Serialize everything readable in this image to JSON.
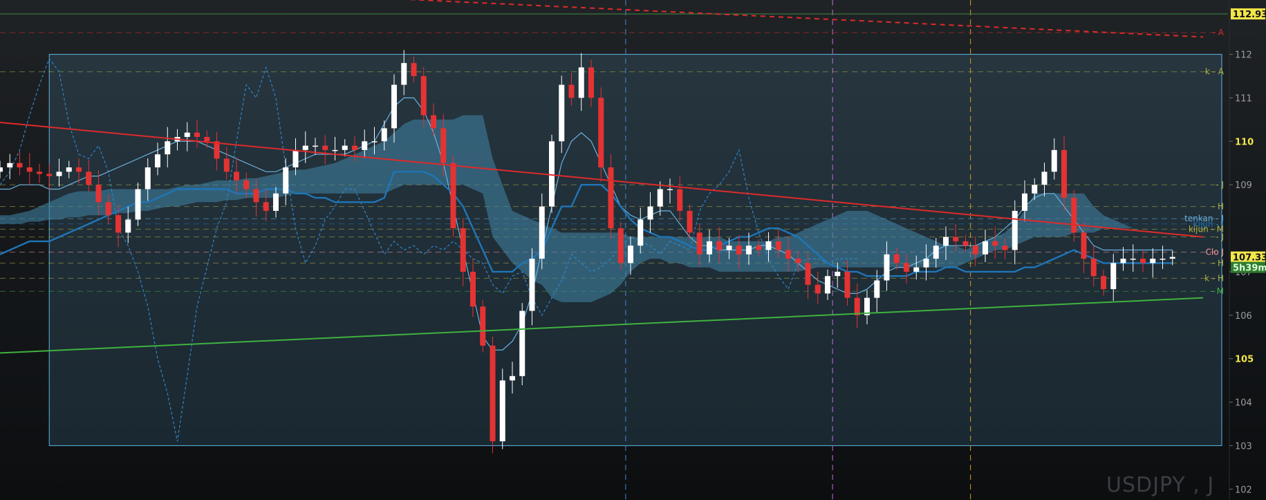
{
  "symbol": "USDJPY , J",
  "colors": {
    "bull": "#ffffff",
    "bear": "#e53333",
    "cloud": "#3f7f9f",
    "kijun": "#1f76b8",
    "tenkan": "#6bb3e0",
    "chikou": "#2f86c8",
    "red_line": "#e02a2a",
    "green_line": "#3fb33f",
    "level_yellow": "#b3b33f",
    "price_tag": "#f2e64a"
  },
  "chart_data": {
    "type": "candlestick",
    "ylim": [
      101.75,
      113.25
    ],
    "x_count": 120,
    "y_ticks": [
      {
        "value": 112,
        "label": "112",
        "major": false
      },
      {
        "value": 111,
        "label": "111",
        "major": false
      },
      {
        "value": 110,
        "label": "110",
        "major": true
      },
      {
        "value": 109,
        "label": "109",
        "major": false
      },
      {
        "value": 107,
        "label": "107",
        "major": false
      },
      {
        "value": 106,
        "label": "106",
        "major": false
      },
      {
        "value": 105,
        "label": "105",
        "major": true
      },
      {
        "value": 104,
        "label": "104",
        "major": false
      },
      {
        "value": 103,
        "label": "103",
        "major": false
      },
      {
        "value": 102,
        "label": "102",
        "major": false
      }
    ],
    "price_tags": [
      {
        "value": 112.93,
        "label": "112.93",
        "style": "yellow"
      },
      {
        "value": 107.339,
        "label": "107.339",
        "style": "yellow"
      },
      {
        "value": 107.1,
        "label": "5h39m",
        "style": "green"
      }
    ],
    "levels": [
      {
        "value": 112.5,
        "label": "- A",
        "color": "#e02a2a"
      },
      {
        "value": 111.6,
        "label": "k - A",
        "color": "#b3b33f"
      },
      {
        "value": 109.0,
        "label": "- J",
        "color": "#b3b33f"
      },
      {
        "value": 108.5,
        "label": "- H",
        "color": "#b3b33f"
      },
      {
        "value": 108.22,
        "label": "tenkan - J",
        "color": "#6bb3e0"
      },
      {
        "value": 108.1,
        "label": "kijun - J",
        "color": "#1f76b8"
      },
      {
        "value": 107.98,
        "label": "kijun - M",
        "color": "#b3b33f"
      },
      {
        "value": 107.8,
        "label": "- J",
        "color": "#b3b33f"
      },
      {
        "value": 107.45,
        "label": "Clo J",
        "color": "#ff9a9a"
      },
      {
        "value": 107.2,
        "label": "- H",
        "color": "#b3b33f"
      },
      {
        "value": 106.85,
        "label": "k - H",
        "color": "#b3b33f"
      },
      {
        "value": 106.55,
        "label": "- M",
        "color": "#3fb33f"
      },
      {
        "value": 101.55,
        "label": "- M",
        "color": "#c8c8c8"
      }
    ],
    "close_series": [
      109.4,
      109.5,
      109.4,
      109.3,
      109.25,
      109.2,
      109.3,
      109.4,
      109.3,
      109.0,
      108.6,
      108.3,
      107.9,
      108.2,
      108.9,
      109.4,
      109.7,
      110.0,
      110.1,
      110.2,
      110.1,
      110.0,
      109.6,
      109.3,
      109.1,
      108.9,
      108.6,
      108.4,
      108.8,
      109.4,
      109.8,
      109.9,
      109.9,
      109.8,
      109.8,
      109.9,
      109.8,
      110.0,
      110.0,
      110.3,
      111.3,
      111.8,
      111.5,
      110.6,
      110.3,
      109.5,
      108.0,
      107.0,
      106.2,
      105.3,
      103.1,
      104.5,
      104.6,
      106.1,
      107.3,
      108.5,
      110.0,
      111.3,
      111.0,
      111.7,
      111.0,
      109.4,
      108.0,
      107.2,
      107.6,
      108.2,
      108.5,
      108.9,
      108.9,
      108.4,
      107.9,
      107.4,
      107.7,
      107.5,
      107.6,
      107.4,
      107.6,
      107.5,
      107.7,
      107.5,
      107.3,
      107.2,
      106.7,
      106.5,
      106.9,
      107.0,
      106.4,
      106.0,
      106.4,
      106.8,
      107.4,
      107.2,
      107.0,
      107.1,
      107.3,
      107.6,
      107.8,
      107.7,
      107.6,
      107.4,
      107.7,
      107.6,
      107.5,
      108.4,
      108.8,
      109.0,
      109.3,
      109.8,
      108.7,
      107.9,
      107.3,
      106.9,
      106.6,
      107.2,
      107.3,
      107.3,
      107.2,
      107.3,
      107.3,
      107.34
    ],
    "kijun_series": [
      107.4,
      107.5,
      107.6,
      107.7,
      107.7,
      107.7,
      107.8,
      107.9,
      108.0,
      108.1,
      108.2,
      108.3,
      108.4,
      108.5,
      108.6,
      108.6,
      108.7,
      108.8,
      108.9,
      108.9,
      108.9,
      108.9,
      108.9,
      108.9,
      108.8,
      108.8,
      108.8,
      108.9,
      108.9,
      108.9,
      108.8,
      108.8,
      108.7,
      108.7,
      108.6,
      108.6,
      108.6,
      108.6,
      108.6,
      108.7,
      109.3,
      109.3,
      109.3,
      109.3,
      109.2,
      109.0,
      108.8,
      108.5,
      108.0,
      107.5,
      107.0,
      107.0,
      107.0,
      107.2,
      107.3,
      107.5,
      108.0,
      108.5,
      108.5,
      109.0,
      109.0,
      109.0,
      108.8,
      108.5,
      108.2,
      108.0,
      107.9,
      107.8,
      107.8,
      107.7,
      107.6,
      107.5,
      107.5,
      107.6,
      107.7,
      107.8,
      107.8,
      107.9,
      108.0,
      108.0,
      107.9,
      107.8,
      107.6,
      107.4,
      107.2,
      107.1,
      107.0,
      107.0,
      106.9,
      106.9,
      106.9,
      106.9,
      106.9,
      107.0,
      107.0,
      107.0,
      107.1,
      107.1,
      107.0,
      107.0,
      107.0,
      107.0,
      107.0,
      107.0,
      107.1,
      107.1,
      107.2,
      107.3,
      107.4,
      107.5,
      107.4,
      107.3,
      107.2,
      107.2,
      107.2,
      107.2,
      107.2,
      107.2,
      107.2,
      107.2
    ],
    "tenkan_series": [
      108.9,
      108.9,
      109.0,
      109.0,
      109.0,
      108.9,
      108.9,
      109.0,
      109.1,
      109.2,
      109.2,
      109.3,
      109.4,
      109.5,
      109.6,
      109.7,
      109.8,
      109.9,
      110.0,
      110.0,
      110.0,
      109.9,
      109.8,
      109.7,
      109.6,
      109.5,
      109.4,
      109.3,
      109.3,
      109.4,
      109.5,
      109.6,
      109.7,
      109.7,
      109.7,
      109.7,
      109.8,
      109.9,
      110.0,
      110.4,
      110.8,
      111.0,
      111.0,
      110.7,
      110.2,
      109.5,
      108.5,
      107.5,
      106.5,
      105.5,
      105.2,
      105.2,
      105.4,
      105.8,
      106.5,
      107.5,
      108.5,
      109.5,
      110.0,
      110.2,
      110.0,
      109.5,
      109.0,
      108.5,
      108.3,
      108.2,
      108.3,
      108.4,
      108.4,
      108.1,
      107.8,
      107.6,
      107.6,
      107.5,
      107.5,
      107.5,
      107.5,
      107.6,
      107.6,
      107.5,
      107.4,
      107.2,
      107.0,
      106.8,
      106.7,
      106.6,
      106.5,
      106.5,
      106.6,
      106.8,
      107.0,
      107.1,
      107.1,
      107.2,
      107.3,
      107.5,
      107.6,
      107.6,
      107.6,
      107.6,
      107.7,
      107.8,
      108.0,
      108.2,
      108.5,
      108.7,
      108.8,
      108.8,
      108.5,
      108.2,
      107.9,
      107.6,
      107.5,
      107.5,
      107.5,
      107.5,
      107.5,
      107.5,
      107.5,
      107.5
    ],
    "cloud_top": [
      108.3,
      108.3,
      108.35,
      108.4,
      108.5,
      108.6,
      108.7,
      108.8,
      108.85,
      108.85,
      108.85,
      108.9,
      108.9,
      108.9,
      108.9,
      108.9,
      108.9,
      108.9,
      108.95,
      109.0,
      109.0,
      109.05,
      109.1,
      109.1,
      109.1,
      109.15,
      109.15,
      109.2,
      109.25,
      109.3,
      109.35,
      109.35,
      109.4,
      109.45,
      109.5,
      109.6,
      109.7,
      109.8,
      109.9,
      110.0,
      110.2,
      110.4,
      110.5,
      110.5,
      110.5,
      110.5,
      110.5,
      110.6,
      110.6,
      110.6,
      109.6,
      109.0,
      108.4,
      108.3,
      108.2,
      108.1,
      108.0,
      107.9,
      107.9,
      107.9,
      107.9,
      107.9,
      107.9,
      107.9,
      107.8,
      107.8,
      107.8,
      107.8,
      107.8,
      107.8,
      107.8,
      107.8,
      107.8,
      107.8,
      107.7,
      107.7,
      107.7,
      107.7,
      107.7,
      107.8,
      107.8,
      107.9,
      108.0,
      108.1,
      108.2,
      108.3,
      108.4,
      108.4,
      108.4,
      108.3,
      108.2,
      108.1,
      108.0,
      107.9,
      107.8,
      107.7,
      107.6,
      107.6,
      107.5,
      107.6,
      107.7,
      107.8,
      107.9,
      108.1,
      108.4,
      108.8,
      108.8,
      108.8,
      108.8,
      108.8,
      108.8,
      108.5,
      108.3,
      108.2,
      108.1,
      108.0,
      108.0,
      108.0,
      108.0,
      108.0
    ],
    "cloud_bottom": [
      108.1,
      108.1,
      108.1,
      108.15,
      108.15,
      108.2,
      108.2,
      108.25,
      108.25,
      108.3,
      108.3,
      108.3,
      108.35,
      108.35,
      108.4,
      108.4,
      108.45,
      108.5,
      108.5,
      108.55,
      108.6,
      108.6,
      108.6,
      108.65,
      108.65,
      108.7,
      108.7,
      108.7,
      108.7,
      108.75,
      108.8,
      108.8,
      108.8,
      108.8,
      108.8,
      108.8,
      108.8,
      108.8,
      108.8,
      108.8,
      108.9,
      109.0,
      109.0,
      109.0,
      109.0,
      109.0,
      109.0,
      109.0,
      108.9,
      108.8,
      107.8,
      107.5,
      107.2,
      107.0,
      106.8,
      106.7,
      106.4,
      106.3,
      106.3,
      106.3,
      106.3,
      106.4,
      106.5,
      106.7,
      107.0,
      107.2,
      107.3,
      107.3,
      107.2,
      107.2,
      107.1,
      107.1,
      107.1,
      107.0,
      107.0,
      107.0,
      107.0,
      107.0,
      107.0,
      107.0,
      107.0,
      107.0,
      107.05,
      107.1,
      107.1,
      107.1,
      107.1,
      107.1,
      107.1,
      107.1,
      107.1,
      107.1,
      107.1,
      107.1,
      107.1,
      107.1,
      107.1,
      107.1,
      107.2,
      107.3,
      107.4,
      107.5,
      107.5,
      107.6,
      107.7,
      107.8,
      107.8,
      107.8,
      107.8,
      107.9,
      107.9,
      107.9,
      108.0,
      108.0,
      108.0,
      108.0,
      108.0,
      108.0,
      108.0,
      108.0
    ],
    "chikou_series": [
      109.0,
      109.3,
      109.8,
      110.6,
      111.3,
      111.9,
      111.6,
      110.4,
      109.7,
      109.6,
      109.9,
      109.3,
      108.0,
      107.6,
      107.0,
      106.2,
      105.0,
      104.2,
      103.1,
      104.6,
      106.2,
      107.1,
      108.0,
      108.6,
      110.0,
      111.3,
      111.0,
      111.7,
      111.0,
      109.4,
      108.0,
      107.2,
      107.6,
      108.2,
      108.5,
      108.9,
      108.9,
      108.4,
      107.9,
      107.4,
      107.7,
      107.5,
      107.6,
      107.4,
      107.6,
      107.5,
      107.7,
      107.5,
      107.3,
      107.2,
      106.7,
      106.5,
      106.9,
      107.0,
      106.4,
      106.0,
      106.4,
      106.8,
      107.4,
      107.2,
      107.0,
      107.1,
      107.3,
      107.6,
      107.8,
      107.7,
      107.6,
      107.4,
      107.7,
      107.6,
      107.5,
      108.4,
      108.8,
      109.0,
      109.3,
      109.8,
      108.7,
      107.9,
      107.3,
      106.9,
      106.6,
      107.2,
      107.3,
      107.3,
      107.2,
      107.3,
      107.3,
      107.3
    ],
    "trend_lines": [
      {
        "name": "red-trendline",
        "points": [
          [
            -3,
            110.5
          ],
          [
            120,
            107.8
          ]
        ],
        "color": "#e02a2a",
        "dash": false
      },
      {
        "name": "red-dashed-trendline",
        "points": [
          [
            38,
            113.3
          ],
          [
            120,
            112.4
          ]
        ],
        "color": "#e02a2a",
        "dash": true
      },
      {
        "name": "green-trendline",
        "points": [
          [
            -3,
            105.1
          ],
          [
            120,
            106.4
          ]
        ],
        "color": "#3fb33f",
        "dash": false
      }
    ],
    "horizontal_green_line": 112.93,
    "vertical_markers": [
      {
        "x": 63.5,
        "color": "#4d88c8"
      },
      {
        "x": 84.5,
        "color": "#c070e0"
      },
      {
        "x": 98.5,
        "color": "#d4a020"
      },
      {
        "x": 150.5,
        "color": "#4e8a4e"
      }
    ],
    "box": {
      "x0": 5,
      "x1": 124,
      "y0": 112.0,
      "y1": 103.0
    }
  }
}
